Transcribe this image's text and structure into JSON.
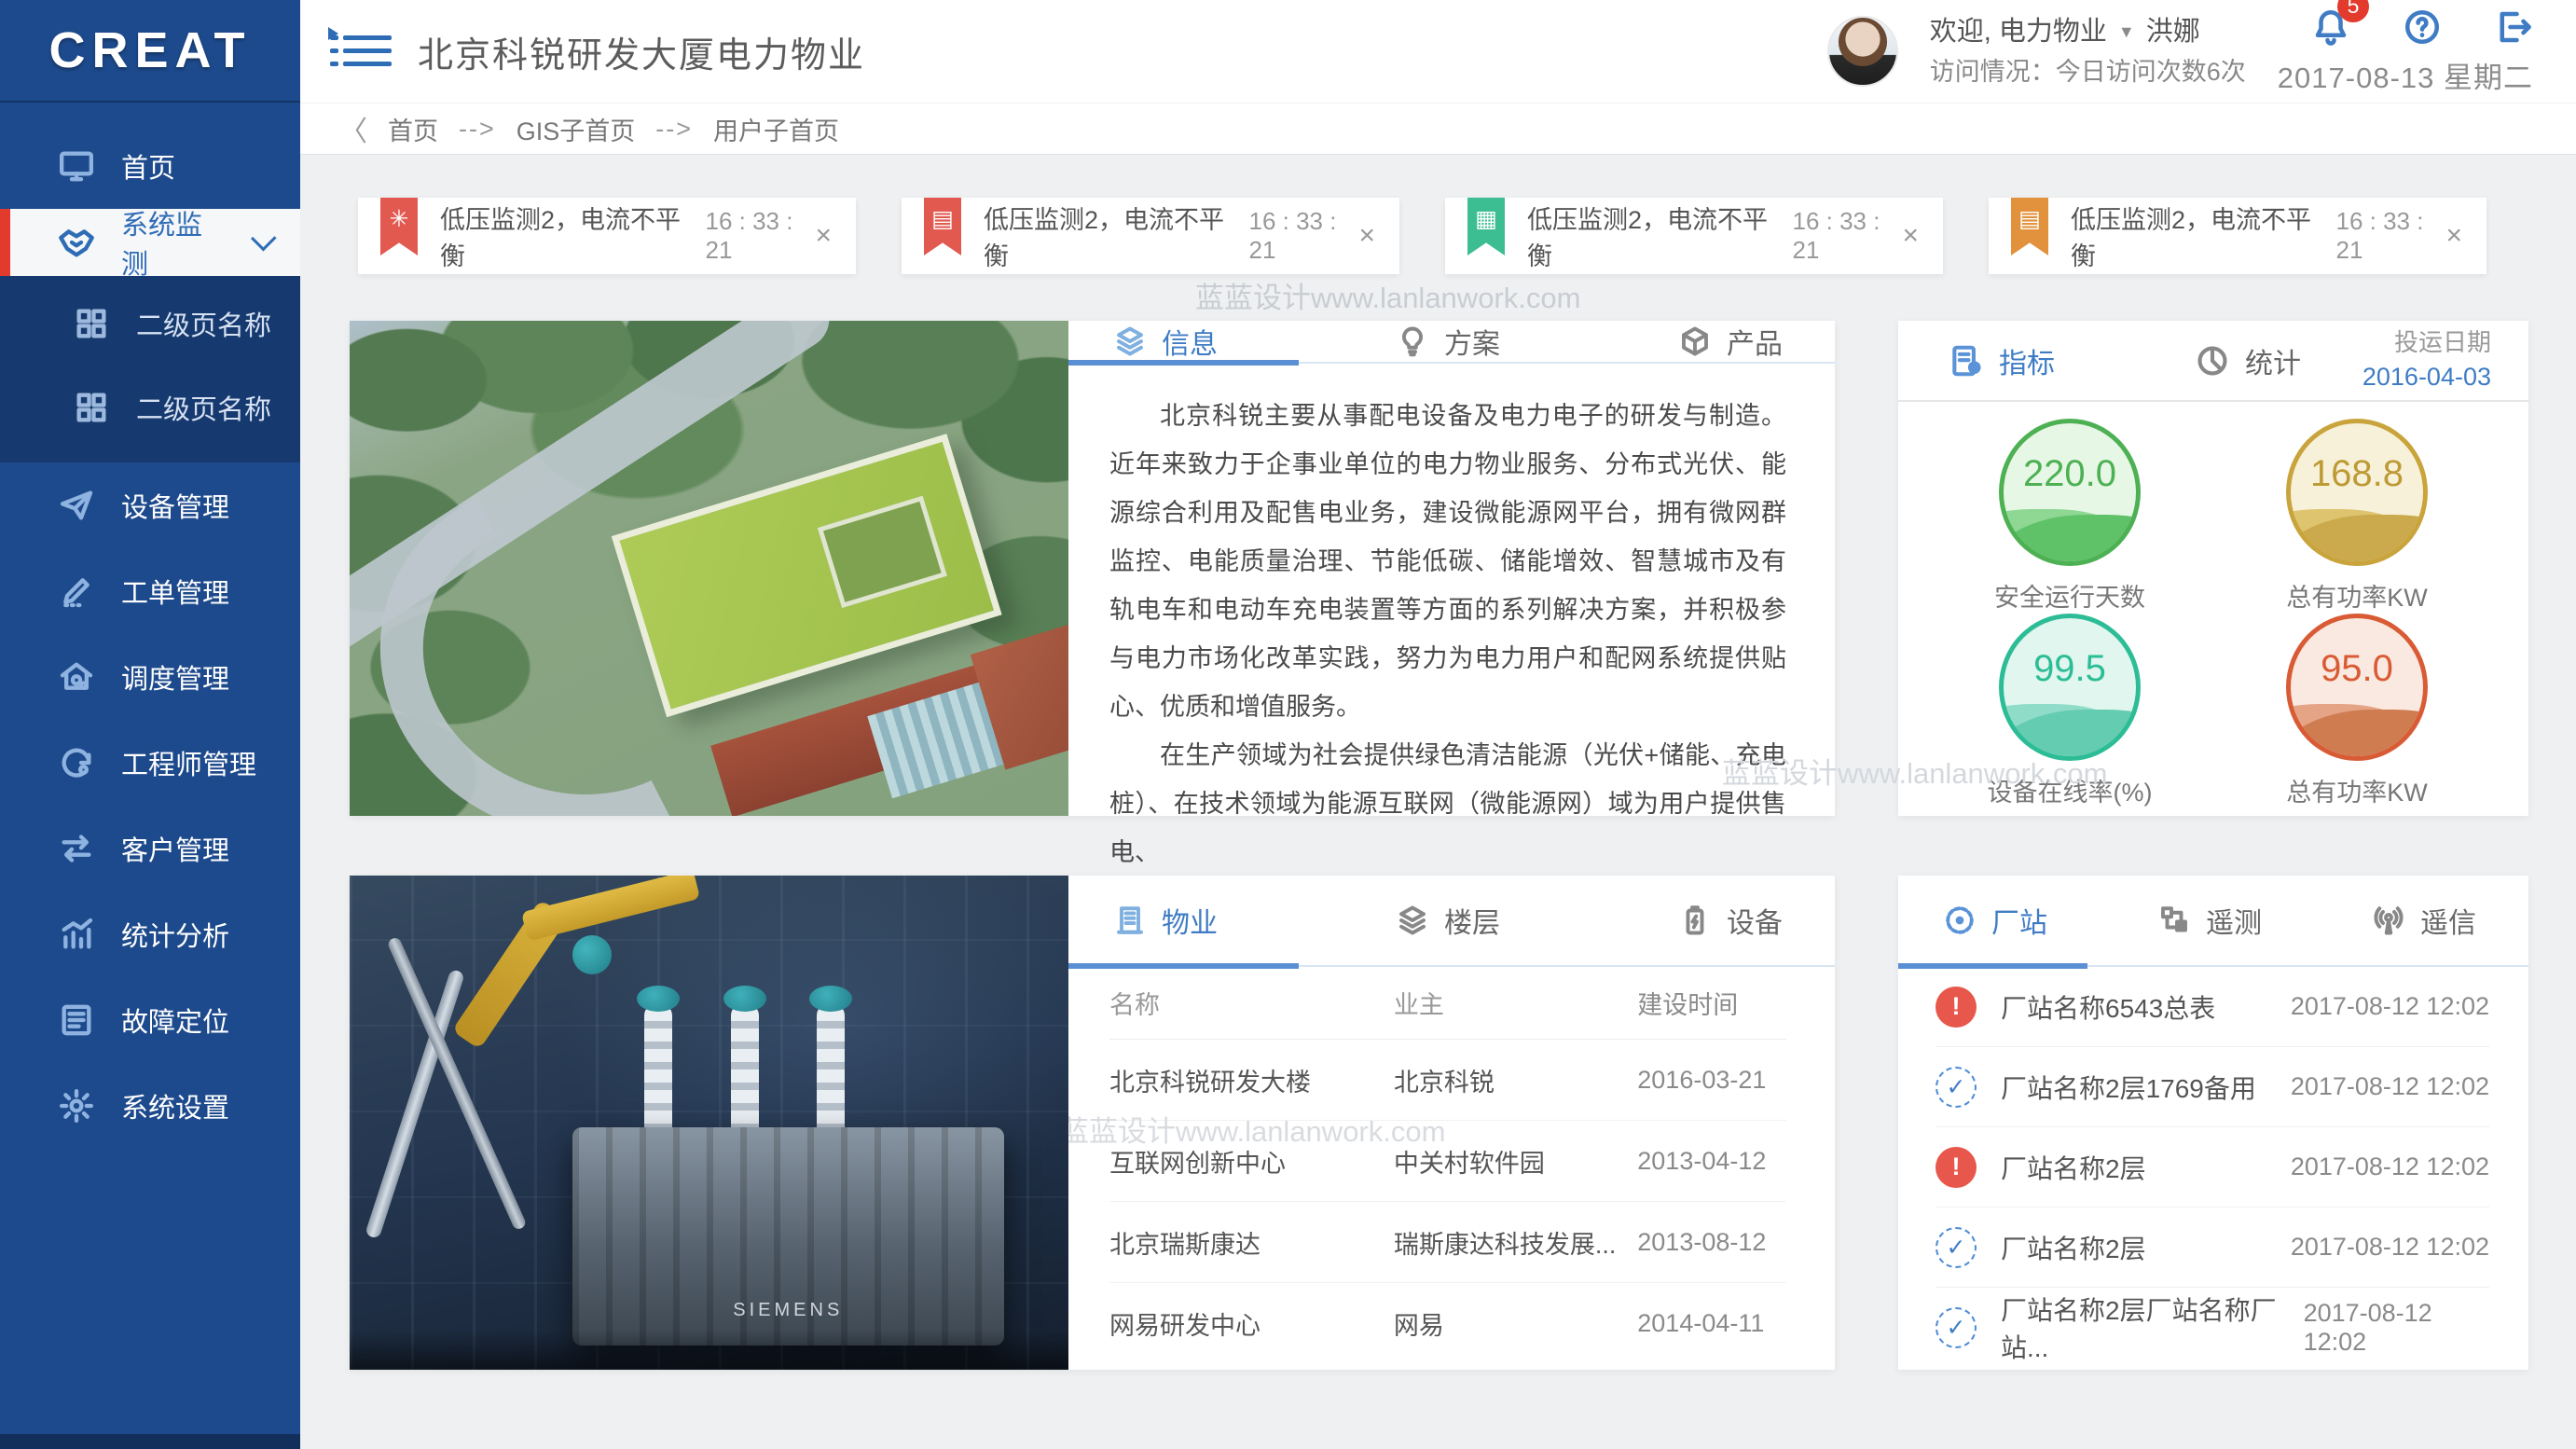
{
  "app": {
    "logo": "CREAT"
  },
  "glyphs": {
    "close": "×",
    "caret_down": "▼",
    "back": "〈",
    "breadcrumb_sep": "-->",
    "exclam": "!",
    "check": "✓"
  },
  "colors": {
    "sidebar": "#1d4a8c",
    "accent_red": "#e23a2c",
    "link_blue": "#3f7cc4",
    "alert_red": "#e25950",
    "alert_green": "#3cbd92",
    "alert_orange": "#e2913c",
    "gauge_green": "#4db153",
    "gauge_gold": "#c9a43c",
    "gauge_teal": "#2dbd96",
    "gauge_orange": "#d95b35"
  },
  "sidebar": {
    "items": [
      {
        "label": "首页"
      },
      {
        "label": "系统监测"
      },
      {
        "label": "二级页名称"
      },
      {
        "label": "二级页名称"
      },
      {
        "label": "设备管理"
      },
      {
        "label": "工单管理"
      },
      {
        "label": "调度管理"
      },
      {
        "label": "工程师管理"
      },
      {
        "label": "客户管理"
      },
      {
        "label": "统计分析"
      },
      {
        "label": "故障定位"
      },
      {
        "label": "系统设置"
      }
    ]
  },
  "header": {
    "title": "北京科锐研发大厦电力物业",
    "welcome": "欢迎, 电力物业",
    "username": "洪娜",
    "visit_info": "访问情况：今日访问次数6次",
    "notification_count": "5",
    "date": "2017-08-13",
    "weekday": "星期二"
  },
  "breadcrumb": {
    "items": [
      "首页",
      "GIS子首页",
      "用户子首页"
    ]
  },
  "alerts": {
    "items": [
      {
        "text": "低压监测2，电流不平衡",
        "time": "16 : 33 : 21",
        "color": "#e25950"
      },
      {
        "text": "低压监测2，电流不平衡",
        "time": "16 : 33 : 21",
        "color": "#e25950"
      },
      {
        "text": "低压监测2，电流不平衡",
        "time": "16 : 33 : 21",
        "color": "#3cbd92"
      },
      {
        "text": "低压监测2，电流不平衡",
        "time": "16 : 33 : 21",
        "color": "#e2913c"
      }
    ]
  },
  "info_card": {
    "tabs": [
      {
        "label": "信息"
      },
      {
        "label": "方案"
      },
      {
        "label": "产品"
      }
    ],
    "p1": "北京科锐主要从事配电设备及电力电子的研发与制造。 近年来致力于企事业单位的电力物业服务、分布式光伏、能源综合利用及配售电业务，建设微能源网平台，拥有微网群监控、电能质量治理、节能低碳、储能增效、智慧城市及有轨电车和电动车充电装置等方面的系列解决方案，并积极参与电力市场化改革实践，努力为电力用户和配网系统提供贴心、优质和增值服务。",
    "p2": "在生产领域为社会提供绿色清洁能源（光伏+储能、充电桩）、在技术领域为能源互联网（微能源网）域为用户提供售电、"
  },
  "metrics_card": {
    "tab_metrics": "指标",
    "tab_stats": "统计",
    "date_label": "投运日期",
    "date_value": "2016-04-03",
    "gauges": [
      {
        "value": "220.0",
        "label": "安全运行天数",
        "color": "#4db153"
      },
      {
        "value": "168.8",
        "label": "总有功率KW",
        "color": "#c9a43c"
      },
      {
        "value": "99.5",
        "label": "设备在线率(%)",
        "color": "#2dbd96"
      },
      {
        "value": "95.0",
        "label": "总有功率KW",
        "color": "#d95b35"
      }
    ]
  },
  "property_card": {
    "tabs": [
      {
        "label": "物业"
      },
      {
        "label": "楼层"
      },
      {
        "label": "设备"
      }
    ],
    "table": {
      "headers": [
        "名称",
        "业主",
        "建设时间"
      ],
      "rows": [
        [
          "北京科锐研发大楼",
          "北京科锐",
          "2016-03-21"
        ],
        [
          "互联网创新中心",
          "中关村软件园",
          "2013-04-12"
        ],
        [
          "北京瑞斯康达",
          "瑞斯康达科技发展...",
          "2013-08-12"
        ],
        [
          "网易研发中心",
          "网易",
          "2014-04-11"
        ]
      ]
    }
  },
  "station_card": {
    "tabs": [
      {
        "label": "厂站"
      },
      {
        "label": "遥测"
      },
      {
        "label": "遥信"
      }
    ],
    "rows": [
      {
        "status": "error",
        "name": "厂站名称6543总表",
        "time": "2017-08-12 12:02"
      },
      {
        "status": "ok",
        "name": "厂站名称2层1769备用",
        "time": "2017-08-12 12:02"
      },
      {
        "status": "error",
        "name": "厂站名称2层",
        "time": "2017-08-12 12:02"
      },
      {
        "status": "ok",
        "name": "厂站名称2层",
        "time": "2017-08-12 12:02"
      },
      {
        "status": "ok",
        "name": "厂站名称2层厂站名称厂站...",
        "time": "2017-08-12 12:02"
      }
    ]
  },
  "images": {
    "transformer_label": "SIEMENS"
  },
  "watermark": "蓝蓝设计www.lanlanwork.com"
}
